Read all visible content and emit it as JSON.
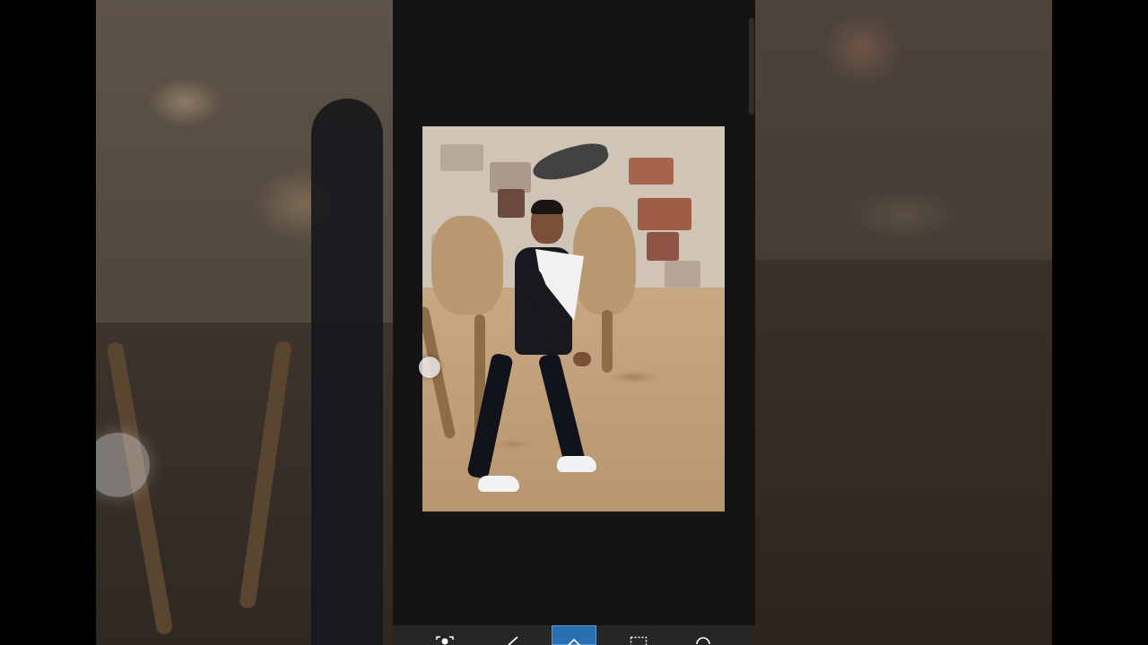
{
  "app": {
    "screen": "photo-editor-canvas"
  },
  "toolbar": {
    "tools": [
      {
        "icon": "person-select-icon",
        "active": false
      },
      {
        "icon": "brush-icon",
        "active": false
      },
      {
        "icon": "eraser-icon",
        "active": true
      },
      {
        "icon": "marquee-select-icon",
        "active": false
      },
      {
        "icon": "undo-history-icon",
        "active": false
      }
    ]
  },
  "colors": {
    "screen_bg": "#141414",
    "toolbar_bg": "#262626",
    "active_tool": "#2a6fb0"
  }
}
